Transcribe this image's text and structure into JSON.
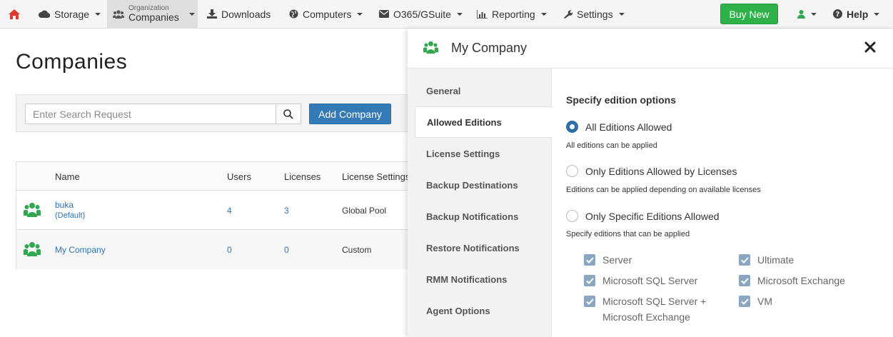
{
  "nav": {
    "storage": "Storage",
    "org_small": "Organization",
    "org_big": "Companies",
    "downloads": "Downloads",
    "computers": "Computers",
    "o365": "O365/GSuite",
    "reporting": "Reporting",
    "settings": "Settings",
    "buy_new": "Buy New",
    "help": "Help"
  },
  "page": {
    "title": "Companies",
    "search_placeholder": "Enter Search Request",
    "add_company": "Add Company"
  },
  "table": {
    "headers": [
      "Name",
      "Users",
      "Licenses",
      "License Settings"
    ],
    "rows": [
      {
        "name": "buka",
        "tag": "(Default)",
        "users": "4",
        "licenses": "3",
        "license_settings": "Global Pool"
      },
      {
        "name": "My Company",
        "tag": "",
        "users": "0",
        "licenses": "0",
        "license_settings": "Custom"
      }
    ]
  },
  "panel": {
    "title": "My Company",
    "nav": [
      "General",
      "Allowed Editions",
      "License Settings",
      "Backup Destinations",
      "Backup Notifications",
      "Restore Notifications",
      "RMM Notifications",
      "Agent Options"
    ],
    "active_nav_index": 1,
    "section_title": "Specify edition options",
    "options": [
      {
        "label": "All Editions Allowed",
        "desc": "All editions can be applied",
        "selected": true
      },
      {
        "label": "Only Editions Allowed by Licenses",
        "desc": "Editions can be applied depending on available licenses",
        "selected": false
      },
      {
        "label": "Only Specific Editions Allowed",
        "desc": "Specify editions that can be applied",
        "selected": false
      }
    ],
    "editions": {
      "left": [
        "Server",
        "Microsoft SQL Server",
        "Microsoft SQL Server + Microsoft Exchange"
      ],
      "right": [
        "Ultimate",
        "Microsoft Exchange",
        "VM"
      ]
    }
  },
  "colors": {
    "accent_blue": "#337ab7",
    "buy_green": "#2fb14a",
    "company_icon_green": "#2fa84f",
    "home_red": "#e03a2f"
  }
}
